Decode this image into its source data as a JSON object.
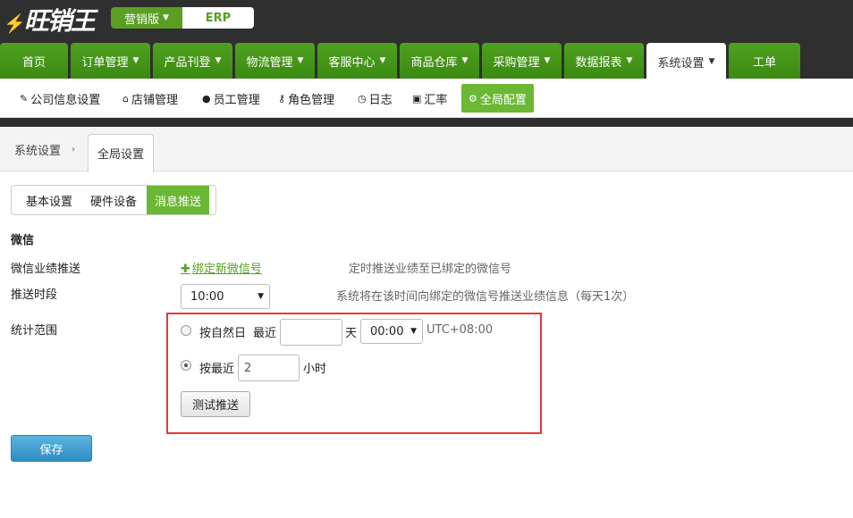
{
  "header": {
    "logo_text": "旺销王",
    "edition_label": "营销版",
    "erp_label": "ERP"
  },
  "nav": [
    {
      "label": "首页",
      "dropdown": false
    },
    {
      "label": "订单管理",
      "dropdown": true
    },
    {
      "label": "产品刊登",
      "dropdown": true
    },
    {
      "label": "物流管理",
      "dropdown": true
    },
    {
      "label": "客服中心",
      "dropdown": true
    },
    {
      "label": "商品仓库",
      "dropdown": true
    },
    {
      "label": "采购管理",
      "dropdown": true
    },
    {
      "label": "数据报表",
      "dropdown": true
    },
    {
      "label": "系统设置",
      "dropdown": true,
      "active": true
    },
    {
      "label": "工单",
      "dropdown": false
    }
  ],
  "subnav": [
    {
      "label": "公司信息设置",
      "icon": "edit-icon"
    },
    {
      "label": "店铺管理",
      "icon": "home-icon"
    },
    {
      "label": "员工管理",
      "icon": "user-icon"
    },
    {
      "label": "角色管理",
      "icon": "key-icon"
    },
    {
      "label": "日志",
      "icon": "clock-icon"
    },
    {
      "label": "汇率",
      "icon": "money-icon"
    },
    {
      "label": "全局配置",
      "icon": "gear-icon",
      "active": true
    }
  ],
  "breadcrumb": {
    "parent": "系统设置",
    "current": "全局设置"
  },
  "tabs": [
    {
      "label": "基本设置"
    },
    {
      "label": "硬件设备"
    },
    {
      "label": "消息推送",
      "active": true
    }
  ],
  "wechat": {
    "section_title": "微信",
    "push_label": "微信业绩推送",
    "bind_link": "绑定新微信号",
    "push_hint": "定时推送业绩至已绑定的微信号",
    "time_label": "推送时段",
    "time_value": "10:00",
    "time_hint": "系统将在该时间向绑定的微信号推送业绩信息（每天1次）",
    "range_label": "统计范围",
    "opt1_label": "按自然日",
    "opt1_recent": "最近",
    "opt1_days_value": "",
    "opt1_day_unit": "天",
    "opt1_time_value": "00:00",
    "opt1_tz": "UTC+08:00",
    "opt2_label": "按最近",
    "opt2_hours_value": "2",
    "opt2_unit": "小时",
    "selected_option": "opt2",
    "test_button": "测试推送"
  },
  "save_button": "保存",
  "colors": {
    "brand_green": "#5a9e24",
    "active_green": "#6ab833",
    "header_dark": "#2f2f2f",
    "highlight_red": "#e53935",
    "save_blue": "#2d8dc2"
  }
}
